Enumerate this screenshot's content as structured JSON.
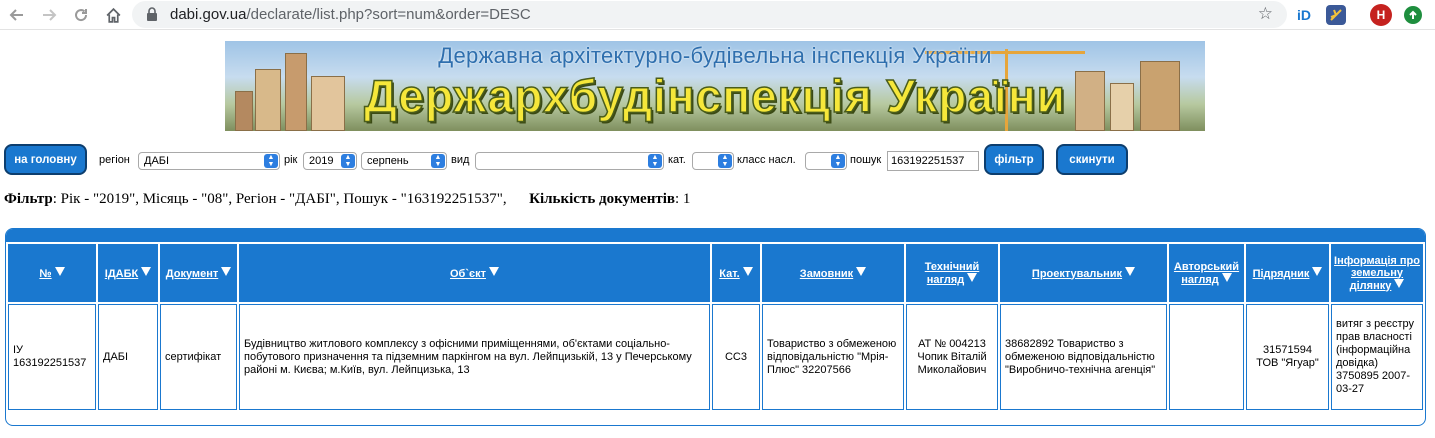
{
  "browser": {
    "url_host": "dabi.gov.ua",
    "url_path": "/declarate/list.php?sort=num&order=DESC",
    "profile_initial": "H"
  },
  "banner": {
    "subtitle": "Державна архітектурно-будівельна інспекція України",
    "title": "Держархбудінспекція України"
  },
  "filters": {
    "home_label": "на головну",
    "region_label": "регіон",
    "region_value": "ДАБІ",
    "year_label": "рік",
    "year_value": "2019",
    "month_value": "серпень",
    "type_label": "вид",
    "type_value": "",
    "cat_label": "кат.",
    "cat_value": "",
    "class_label": "класс насл.",
    "class_value": "",
    "search_label": "пошук",
    "search_value": "163192251537",
    "filter_label": "фільтр",
    "reset_label": "скинути"
  },
  "summary": {
    "filter_label": "Фільтр",
    "filter_text": ": Рік - \"2019\", Місяць - \"08\", Регіон - \"ДАБІ\", Пошук - \"163192251537\",",
    "count_label": "Кількість документів",
    "count_text": ": 1"
  },
  "table": {
    "headers": [
      "№",
      "ІДАБК",
      "Документ",
      "Об`єкт",
      "Кат.",
      "Замовник",
      "Технічний нагляд",
      "Проектувальник",
      "Авторський нагляд",
      "Підрядник",
      "Інформація про земельну ділянку"
    ],
    "rows": [
      {
        "num": "ІУ 163192251537",
        "idabk": "ДАБІ",
        "document": "сертифікат",
        "object": "Будівництво житлового комплексу з офісними приміщеннями, об'єктами соціально-побутового призначення та підземним паркінгом на вул. Лейпцизькій, 13 у Печерському районі м. Києва; м.Київ, вул. Лейпцизька, 13",
        "category": "СС3",
        "customer": "Товариство з обмеженою відповідальністю \"Мрія-Плюс\" 32207566",
        "tech_supervision": "АТ № 004213 Чопик Віталій Миколайович",
        "designer": "38682892 Товариство з обмеженою відповідальністю \"Виробничо-технічна агенція\"",
        "author_supervision": "",
        "contractor": "31571594 ТОВ \"Ягуар\"",
        "land_info": "витяг з реєстру прав власності (інформаційна довідка) 3750895 2007-03-27"
      }
    ]
  },
  "colors": {
    "accent": "#1a78cf"
  }
}
